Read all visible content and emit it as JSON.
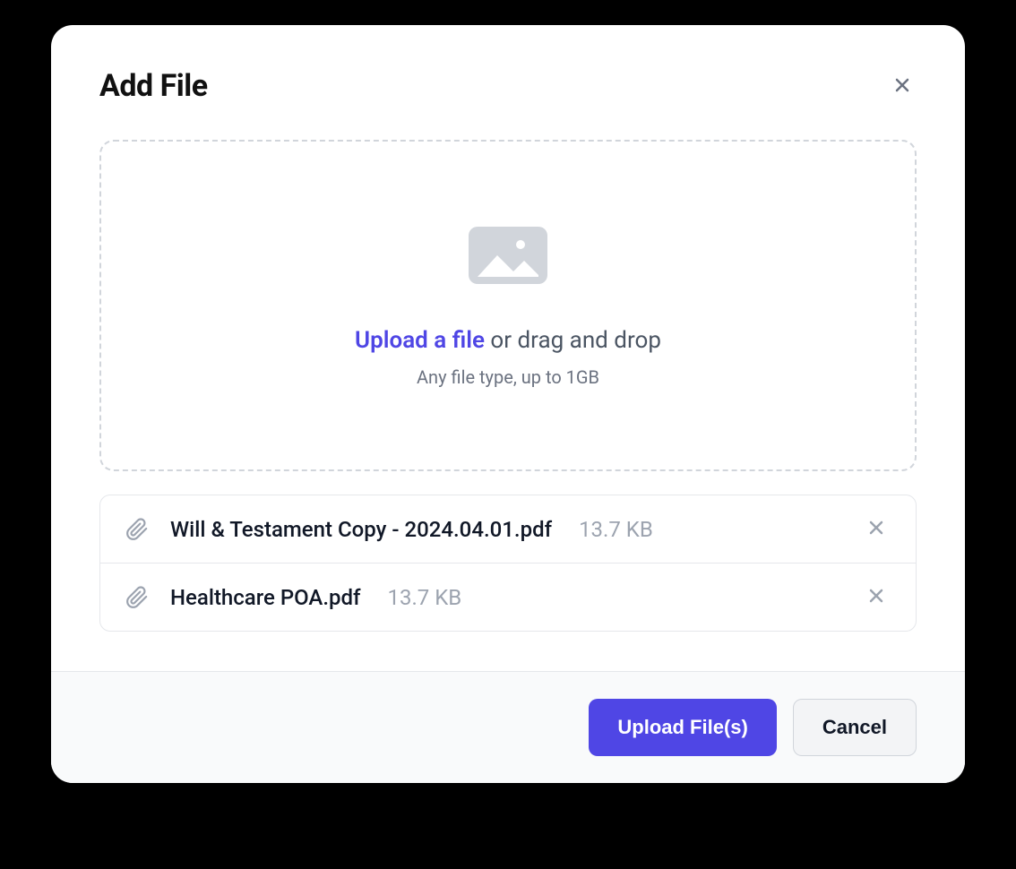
{
  "modal": {
    "title": "Add File",
    "dropzone": {
      "link_text": "Upload a file",
      "rest_text": " or drag and drop",
      "subtext": "Any file type, up to 1GB"
    },
    "files": [
      {
        "name": "Will & Testament Copy - 2024.04.01.pdf",
        "size": "13.7 KB"
      },
      {
        "name": "Healthcare POA.pdf",
        "size": "13.7 KB"
      }
    ],
    "footer": {
      "upload_label": "Upload File(s)",
      "cancel_label": "Cancel"
    }
  }
}
